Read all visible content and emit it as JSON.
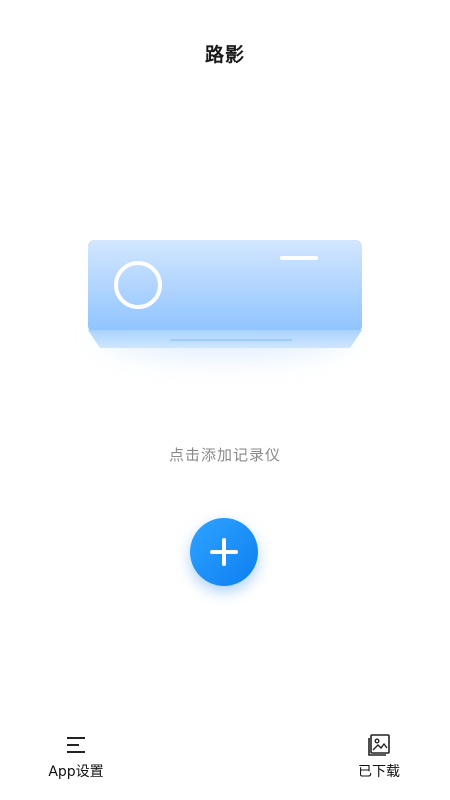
{
  "header": {
    "title": "路影"
  },
  "main": {
    "hint_text": "点击添加记录仪",
    "add_icon": "plus-icon",
    "device_illustration": "dashcam-device-illustration"
  },
  "bottom_nav": {
    "left": {
      "label": "App设置",
      "icon": "menu-icon"
    },
    "right": {
      "label": "已下载",
      "icon": "gallery-icon"
    }
  },
  "colors": {
    "accent": "#1a8cff",
    "hint_text": "#8a8a8a",
    "device_top": "#cfe3ff",
    "device_bottom": "#8cc3ff"
  }
}
